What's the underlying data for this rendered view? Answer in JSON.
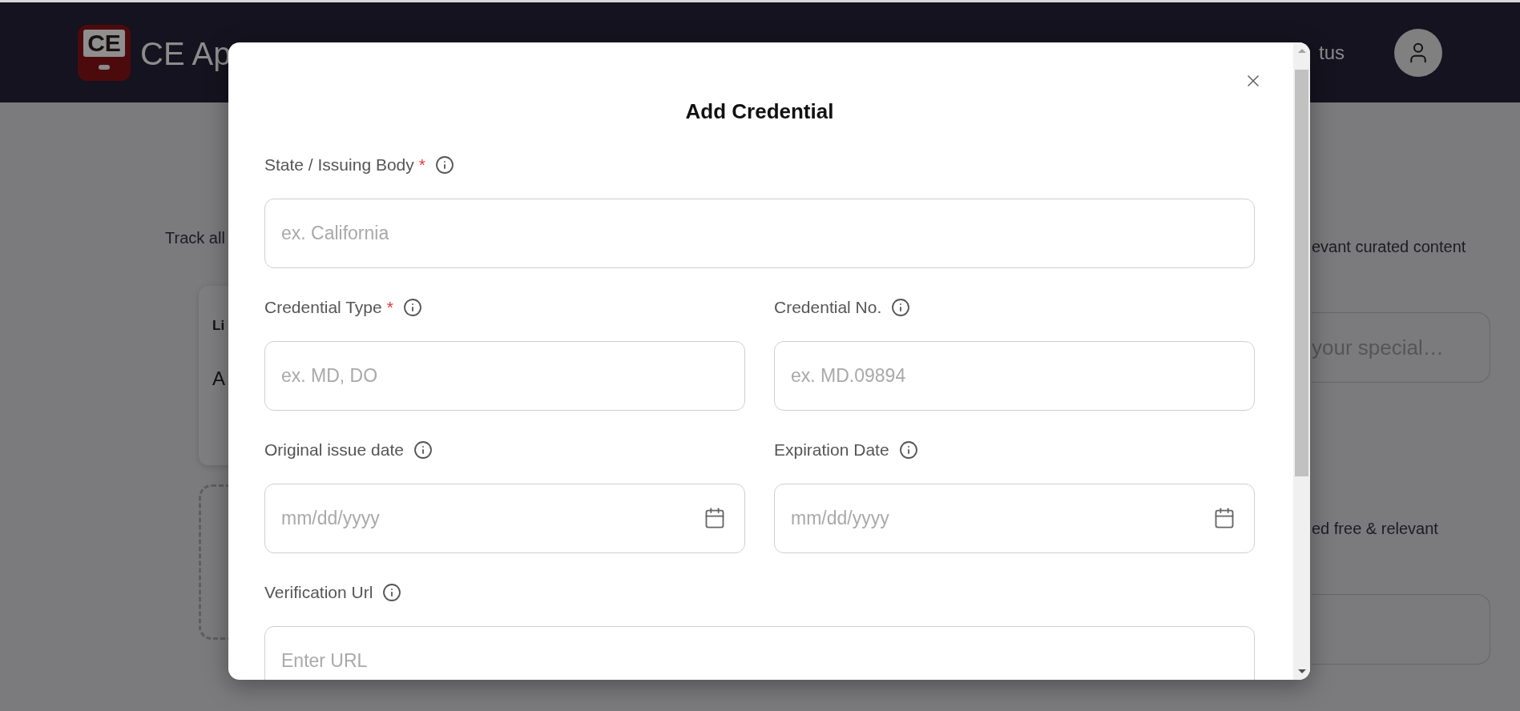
{
  "header": {
    "logo_text": "CE",
    "app_name": "CE Ap",
    "nav_item": "tus"
  },
  "page": {
    "left_text": "Track all",
    "card": {
      "title": "Li",
      "value": "A"
    },
    "right_sections": [
      {
        "text": "evant curated content",
        "placeholder": "your special…"
      },
      {
        "text": "ed free & relevant"
      }
    ]
  },
  "modal": {
    "title": "Add Credential",
    "rows": [
      [
        {
          "kind": "text",
          "label": "State / Issuing Body",
          "required_mark": "*",
          "placeholder": "ex. California"
        }
      ],
      [
        {
          "kind": "text",
          "label": "Credential Type",
          "required_mark": "*",
          "placeholder": "ex. MD, DO"
        },
        {
          "kind": "text",
          "label": "Credential No.",
          "placeholder": "ex. MD.09894"
        }
      ],
      [
        {
          "kind": "date",
          "label": "Original issue date",
          "placeholder": "mm/dd/yyyy"
        },
        {
          "kind": "date",
          "label": "Expiration Date",
          "placeholder": "mm/dd/yyyy"
        }
      ],
      [
        {
          "kind": "text",
          "label": "Verification Url",
          "placeholder": "Enter URL"
        }
      ]
    ]
  }
}
